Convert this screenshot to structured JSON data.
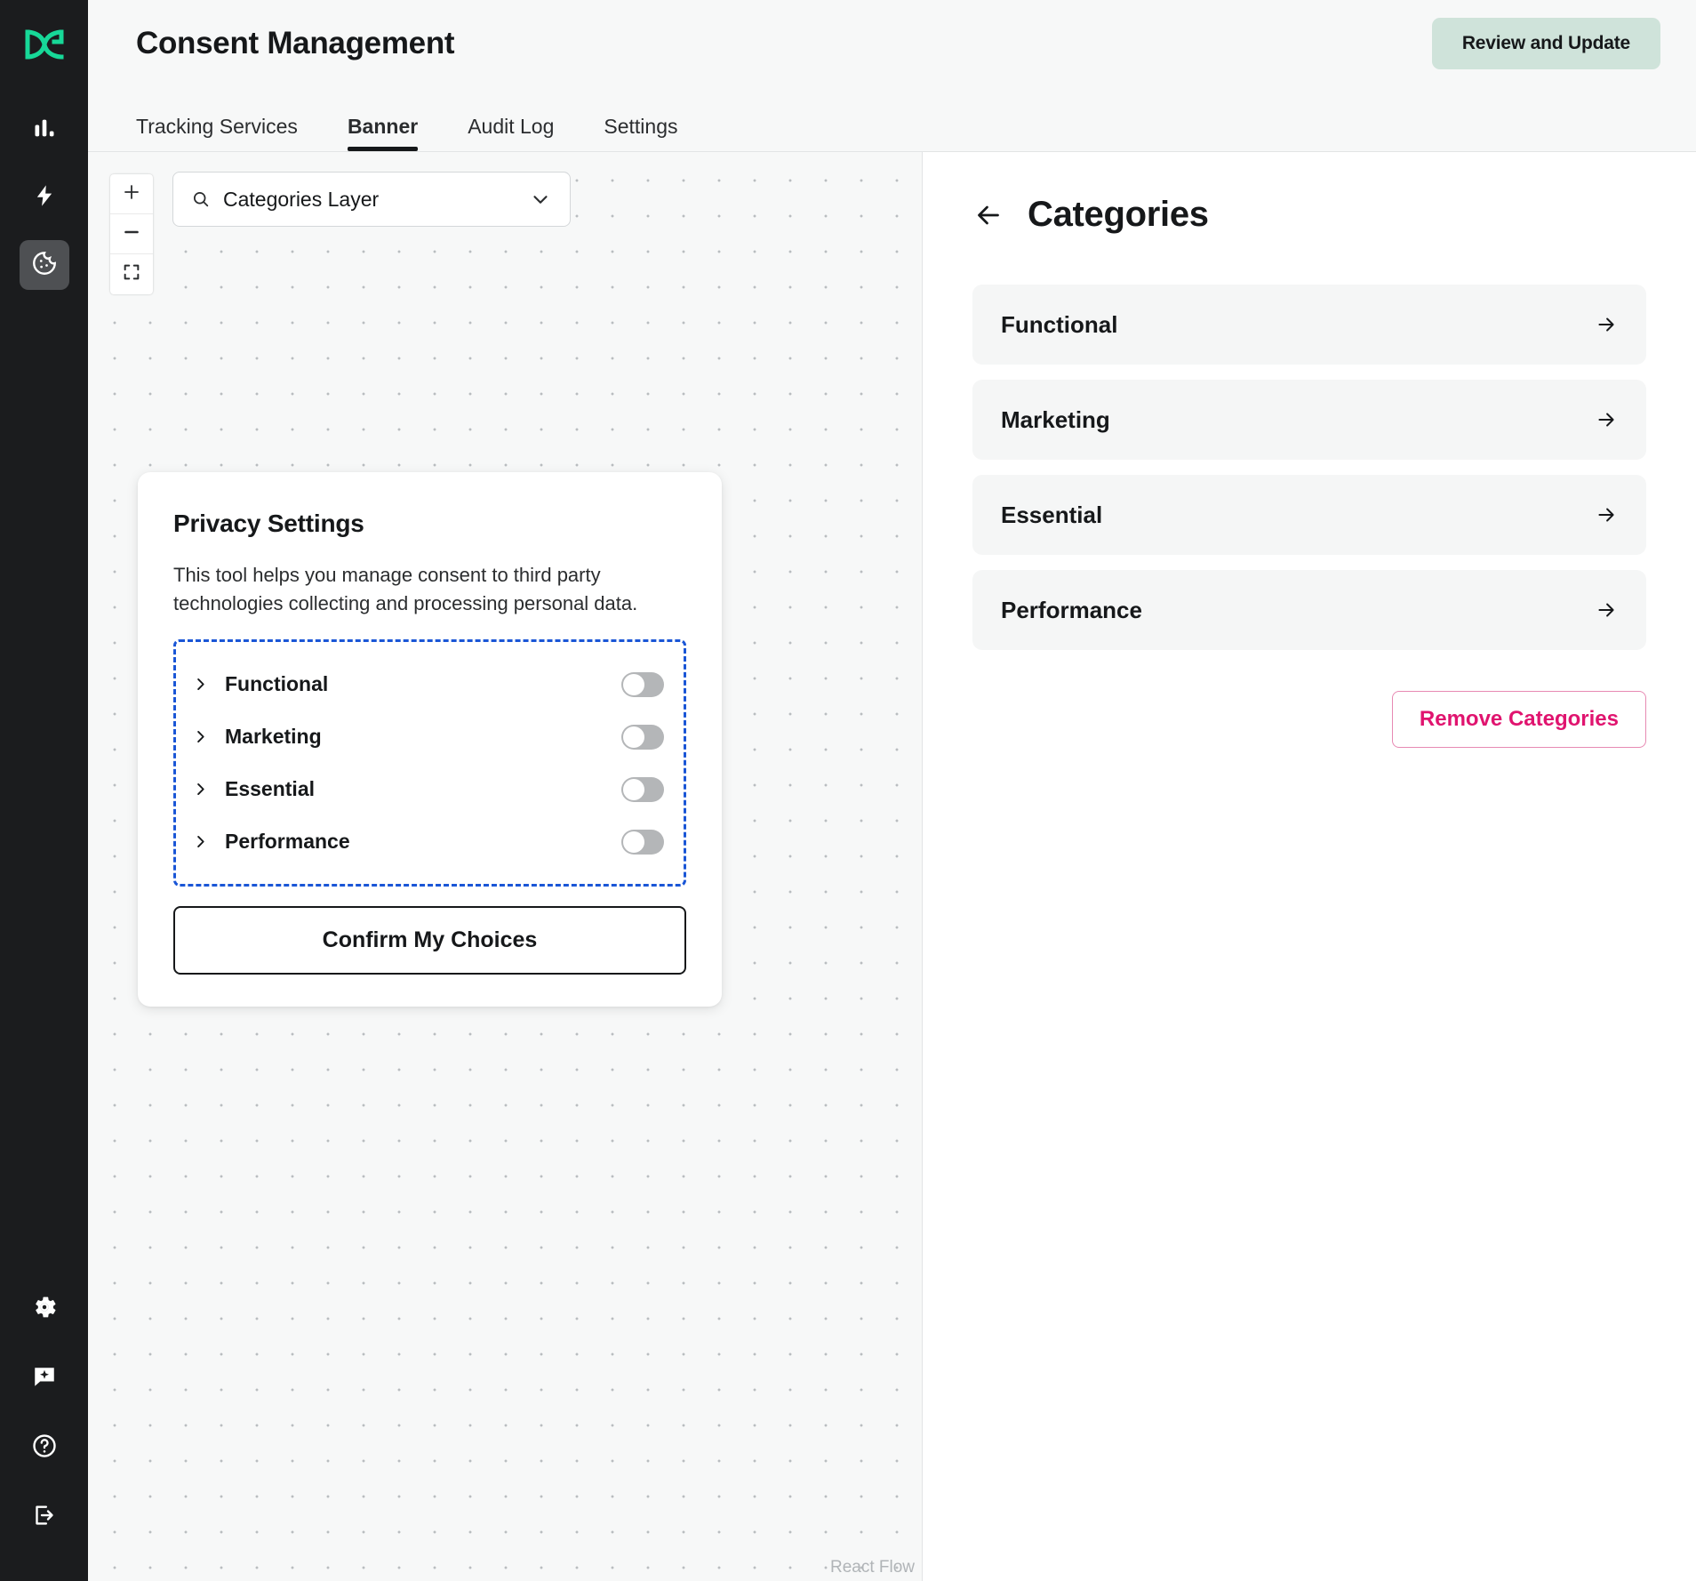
{
  "app": {
    "logo_icon": "dg-logo-icon"
  },
  "rail": {
    "items": [
      {
        "icon": "bar-chart-icon",
        "name": "analytics",
        "active": false
      },
      {
        "icon": "lightning-bolt-icon",
        "name": "automations",
        "active": false
      },
      {
        "icon": "cookie-icon",
        "name": "consent",
        "active": true
      }
    ],
    "bottom_items": [
      {
        "icon": "gear-icon",
        "name": "settings"
      },
      {
        "icon": "chat-sparkle-icon",
        "name": "assistant"
      },
      {
        "icon": "help-circle-icon",
        "name": "help"
      },
      {
        "icon": "logout-icon",
        "name": "logout"
      }
    ]
  },
  "header": {
    "title": "Consent Management",
    "review_button": "Review and Update",
    "tabs": [
      {
        "label": "Tracking Services",
        "active": false
      },
      {
        "label": "Banner",
        "active": true
      },
      {
        "label": "Audit Log",
        "active": false
      },
      {
        "label": "Settings",
        "active": false
      }
    ]
  },
  "canvas": {
    "zoom_controls": [
      {
        "icon": "plus-icon",
        "name": "zoom-in"
      },
      {
        "icon": "minus-icon",
        "name": "zoom-out"
      },
      {
        "icon": "fit-view-icon",
        "name": "fit-view"
      }
    ],
    "layer_select": {
      "value": "Categories Layer",
      "search_icon": "search-icon",
      "chevron_icon": "chevron-down-icon"
    },
    "attribution": "React Flow",
    "banner": {
      "title": "Privacy Settings",
      "description": "This tool helps you manage consent to third party technologies collecting and processing personal data.",
      "categories": [
        {
          "label": "Functional",
          "toggle_on": false
        },
        {
          "label": "Marketing",
          "toggle_on": false
        },
        {
          "label": "Essential",
          "toggle_on": false
        },
        {
          "label": "Performance",
          "toggle_on": false
        }
      ],
      "confirm_button": "Confirm My Choices",
      "selection_color": "#1a56d6"
    }
  },
  "right_panel": {
    "back_icon": "arrow-left-icon",
    "title": "Categories",
    "categories": [
      {
        "label": "Functional",
        "arrow_icon": "arrow-right-icon"
      },
      {
        "label": "Marketing",
        "arrow_icon": "arrow-right-icon"
      },
      {
        "label": "Essential",
        "arrow_icon": "arrow-right-icon"
      },
      {
        "label": "Performance",
        "arrow_icon": "arrow-right-icon"
      }
    ],
    "remove_button": "Remove Categories",
    "remove_button_color": "#e0146f"
  },
  "colors": {
    "rail_bg": "#1b1c1e",
    "logo_green": "#17d898",
    "accent_mint": "#cfe3da",
    "pink": "#e0146f",
    "selection_blue": "#1a56d6"
  }
}
